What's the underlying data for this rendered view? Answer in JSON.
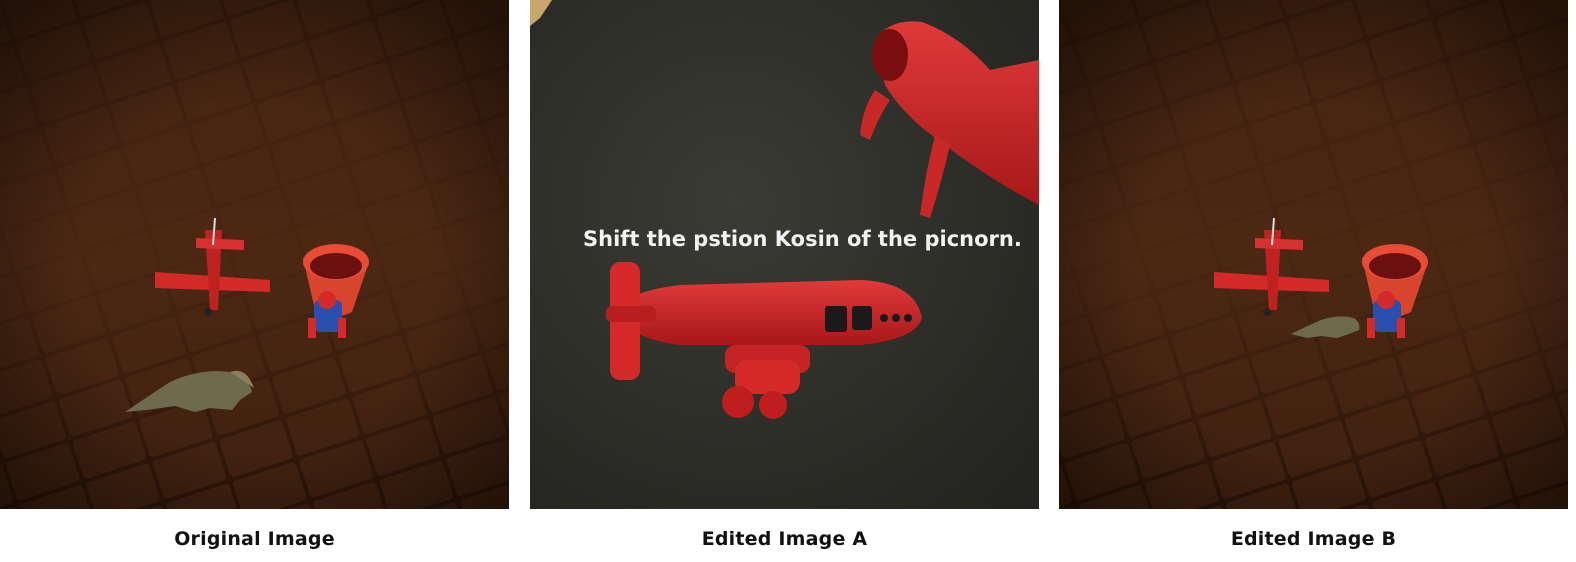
{
  "captions": {
    "original": "Original Image",
    "edited_a": "Edited Image A",
    "edited_b": "Edited Image B"
  },
  "panel_a": {
    "overlay_text": "Shift the pstion Kosin of the picnorn."
  },
  "colors": {
    "floor_dark": "#2a1408",
    "floor_mid": "#4a2612",
    "toy_red": "#d42a2a",
    "slate_bg": "#2f3029",
    "dino": "#6e6a4e"
  }
}
